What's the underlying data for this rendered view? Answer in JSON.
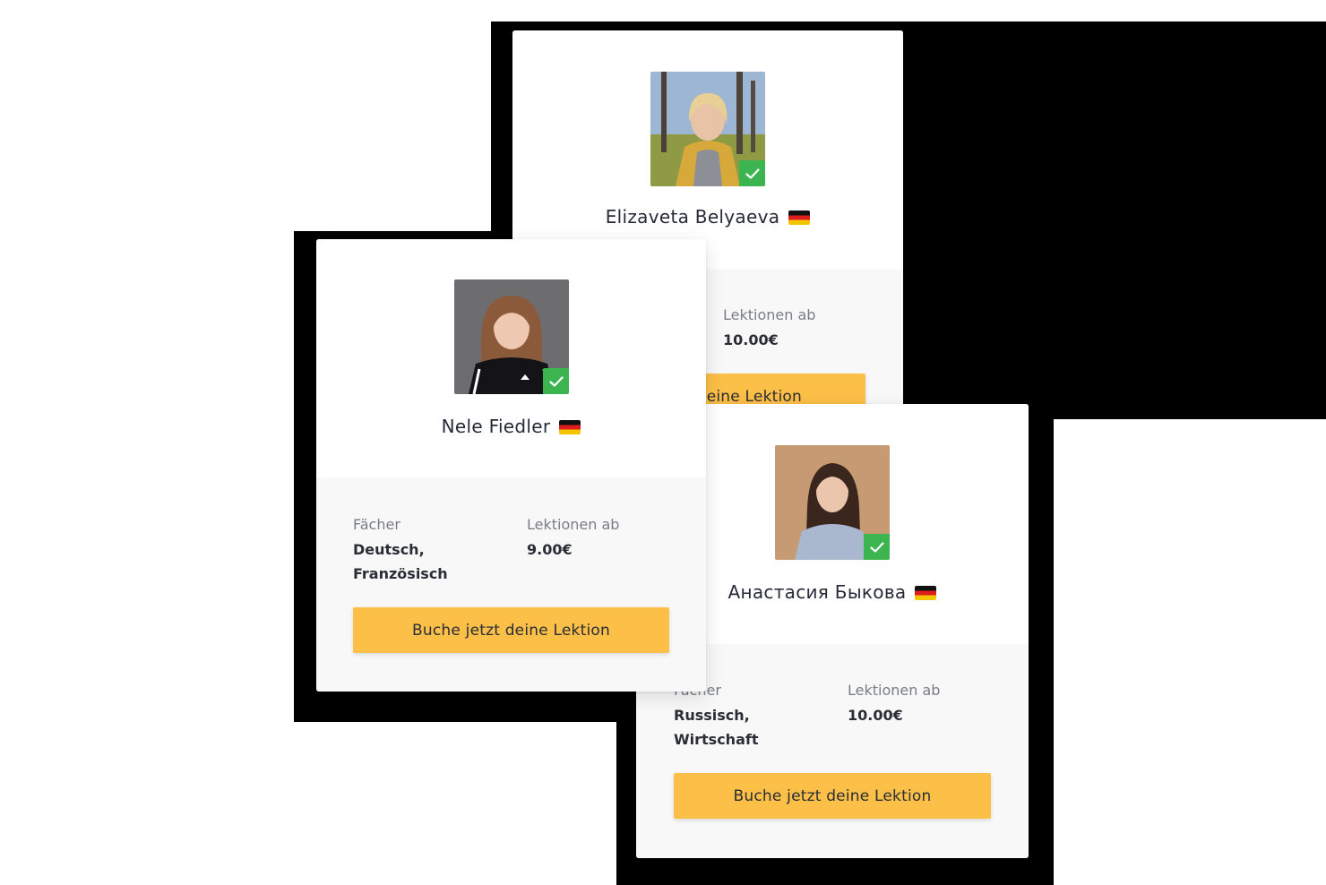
{
  "cards": [
    {
      "name": "Elizaveta Belyaeva",
      "subjects_label": "",
      "subjects": [],
      "price_label": "Lektionen ab",
      "price": "10.00€",
      "button_label": "deine Lektion"
    },
    {
      "name": "Nele Fiedler",
      "subjects_label": "Fächer",
      "subjects": [
        "Deutsch,",
        "Französisch"
      ],
      "price_label": "Lektionen ab",
      "price": "9.00€",
      "button_label": "Buche jetzt deine Lektion"
    },
    {
      "name": "Анастасия Быкова",
      "subjects_label": "Fächer",
      "subjects": [
        "Russisch,",
        "Wirtschaft"
      ],
      "price_label": "Lektionen ab",
      "price": "10.00€",
      "button_label": "Buche jetzt deine Lektion"
    }
  ],
  "colors": {
    "button": "#fcbf47",
    "verified": "#3cb550",
    "flag": [
      "#111111",
      "#dd1d1d",
      "#f5c400"
    ]
  },
  "icons": {
    "verified": "check-icon",
    "flag": "germany-flag-icon"
  }
}
